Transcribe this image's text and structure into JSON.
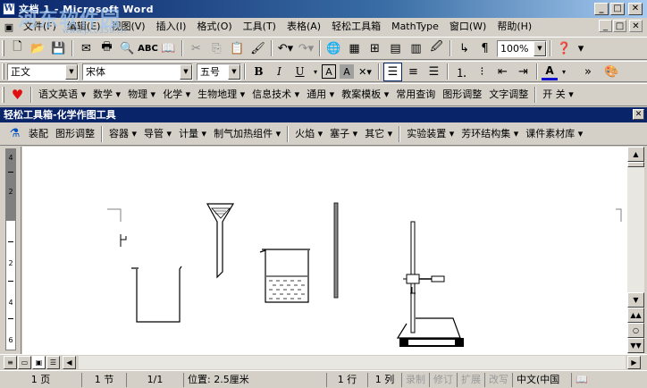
{
  "window": {
    "title": "文档 1 - Microsoft Word",
    "watermark": "河东软件园",
    "watermark_url": "www.pc0359.cn"
  },
  "menu": [
    "文件(F)",
    "编辑(E)",
    "视图(V)",
    "插入(I)",
    "格式(O)",
    "工具(T)",
    "表格(A)",
    "轻松工具箱",
    "MathType",
    "窗口(W)",
    "帮助(H)"
  ],
  "standard_toolbar": {
    "zoom": "100%"
  },
  "format_toolbar": {
    "style": "正文",
    "font": "宋体",
    "size": "五号",
    "bold": "B",
    "italic": "I",
    "underline": "U",
    "border_char": "A",
    "shade_char": "A",
    "color_char": "A"
  },
  "addin_toolbar": [
    "语文英语",
    "数学",
    "物理",
    "化学",
    "生物地理",
    "信息技术",
    "通用",
    "教案模板",
    "常用查询",
    "图形调整",
    "文字调整",
    "开 关"
  ],
  "chem_toolbar": {
    "title": "轻松工具箱-化学作图工具",
    "items": [
      "装配",
      "图形调整",
      "容器",
      "导管",
      "计量",
      "制气加热组件",
      "火焰",
      "塞子",
      "其它",
      "实验装置",
      "芳环结构集",
      "课件素材库"
    ]
  },
  "ruler_numbers": [
    "4",
    "2",
    "2",
    "4",
    "6"
  ],
  "status": {
    "page": "1 页",
    "section": "1 节",
    "pages": "1/1",
    "position": "位置: 2.5厘米",
    "line": "1 行",
    "column": "1 列",
    "rec": "录制",
    "trk": "修订",
    "ext": "扩展",
    "ovr": "改写",
    "lang": "中文(中国"
  }
}
